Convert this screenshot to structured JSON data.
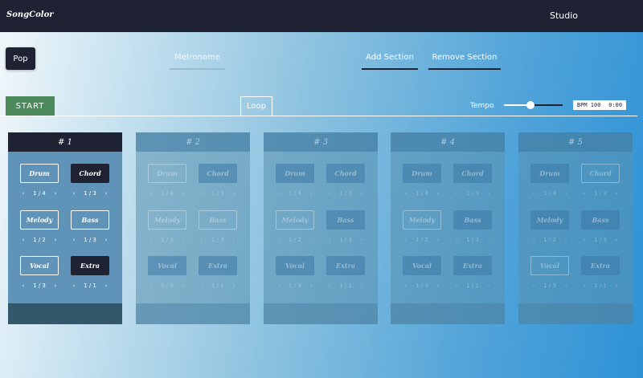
{
  "header": {
    "brand": "SongColor",
    "nav_studio": "Studio"
  },
  "toolbar": {
    "genre": "Pop",
    "metronome": "Metronome",
    "add_section": "Add Section",
    "remove_section": "Remove Section",
    "start": "START",
    "loop": "Loop",
    "tempo_label": "Tempo",
    "tempo_level": 0.45,
    "bpm_text": "BPM 100",
    "time_text": "0:00"
  },
  "nav_icons": {
    "prev": "‹",
    "next": "›"
  },
  "sections": [
    {
      "title": "# 1",
      "instruments": [
        {
          "label": "Drum",
          "page": "1 / 4"
        },
        {
          "label": "Chord",
          "page": "1 / 3"
        },
        {
          "label": "Melody",
          "page": "1 / 2"
        },
        {
          "label": "Bass",
          "page": "1 / 3"
        },
        {
          "label": "Vocal",
          "page": "1 / 3"
        },
        {
          "label": "Extra",
          "page": "1 / 1"
        }
      ]
    },
    {
      "title": "# 2",
      "instruments": [
        {
          "label": "Drum",
          "page": "1 / 4"
        },
        {
          "label": "Chord",
          "page": "1 / 3"
        },
        {
          "label": "Melody",
          "page": "1 / 2"
        },
        {
          "label": "Bass",
          "page": "1 / 3"
        },
        {
          "label": "Vocal",
          "page": "1 / 3"
        },
        {
          "label": "Extra",
          "page": "1 / 1"
        }
      ]
    },
    {
      "title": "# 3",
      "instruments": [
        {
          "label": "Drum",
          "page": "1 / 4"
        },
        {
          "label": "Chord",
          "page": "1 / 3"
        },
        {
          "label": "Melody",
          "page": "1 / 2"
        },
        {
          "label": "Bass",
          "page": "1 / 3"
        },
        {
          "label": "Vocal",
          "page": "1 / 3"
        },
        {
          "label": "Extra",
          "page": "1 / 1"
        }
      ]
    },
    {
      "title": "# 4",
      "instruments": [
        {
          "label": "Drum",
          "page": "1 / 4"
        },
        {
          "label": "Chord",
          "page": "1 / 3"
        },
        {
          "label": "Melody",
          "page": "1 / 2"
        },
        {
          "label": "Bass",
          "page": "1 / 3"
        },
        {
          "label": "Vocal",
          "page": "1 / 3"
        },
        {
          "label": "Extra",
          "page": "1 / 1"
        }
      ]
    },
    {
      "title": "# 5",
      "instruments": [
        {
          "label": "Drum",
          "page": "1 / 4"
        },
        {
          "label": "Chord",
          "page": "1 / 3"
        },
        {
          "label": "Melody",
          "page": "1 / 2"
        },
        {
          "label": "Bass",
          "page": "1 / 3"
        },
        {
          "label": "Vocal",
          "page": "1 / 3"
        },
        {
          "label": "Extra",
          "page": "1 / 1"
        }
      ]
    }
  ]
}
